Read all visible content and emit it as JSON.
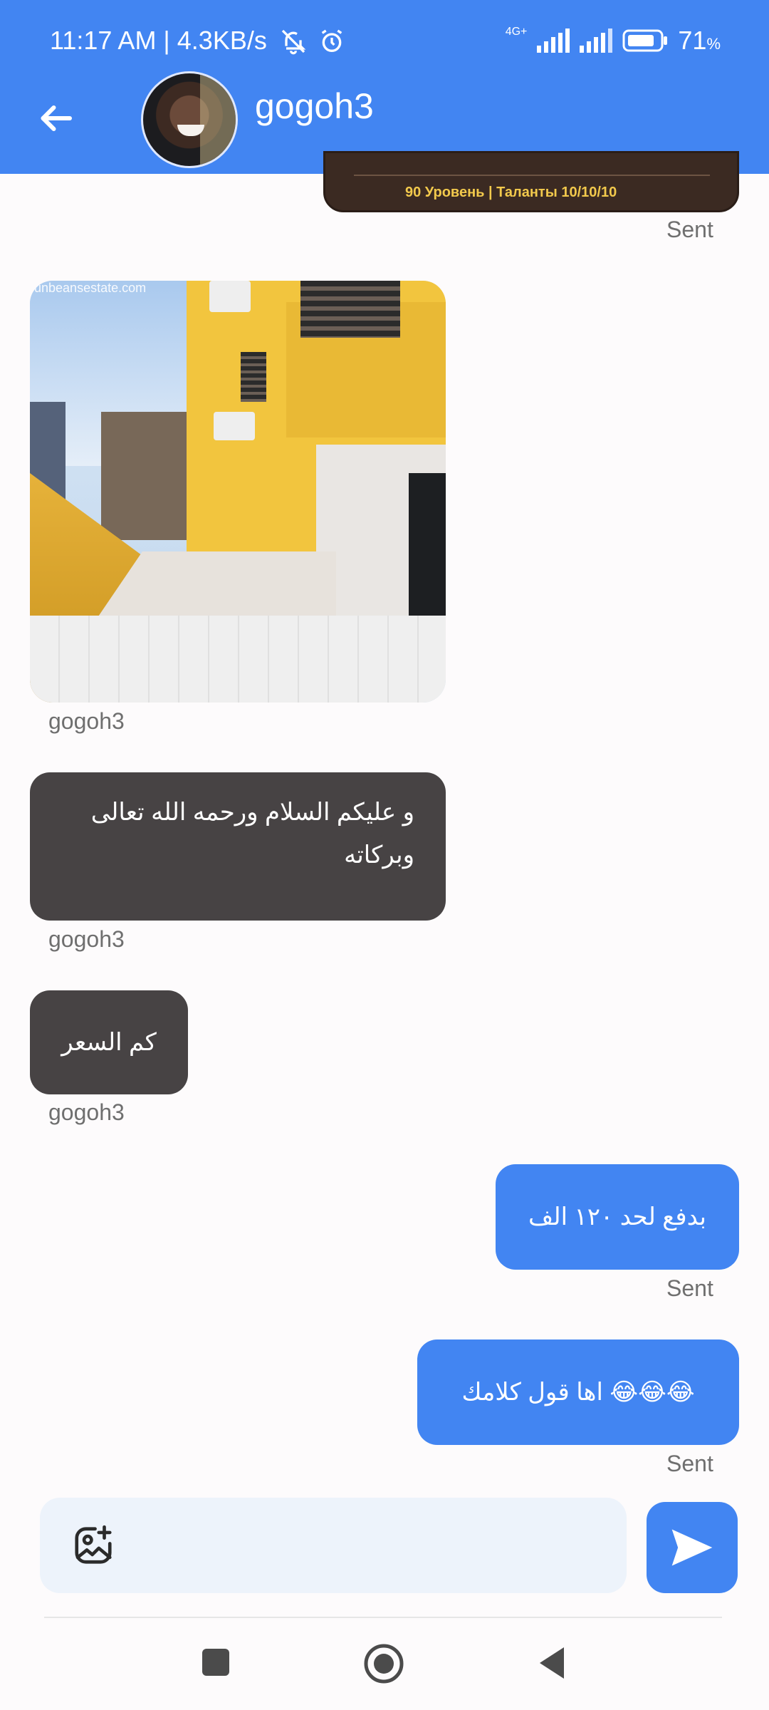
{
  "status_bar": {
    "time": "11:17 AM | 4.3KB/s",
    "network": "4G+",
    "battery": "71",
    "battery_unit": "%"
  },
  "header": {
    "back_icon": "arrow-left-icon",
    "contact_name": "gogoh3"
  },
  "previous_message": {
    "level_text": "90 Уровень | Таланты 10/10/10",
    "status": "Sent"
  },
  "messages": [
    {
      "type": "image",
      "sender": "gogoh3",
      "watermark": "unbeansestate.com"
    },
    {
      "type": "text",
      "direction": "received",
      "text": "و عليكم السلام ورحمه الله تعالى وبركاته",
      "sender": "gogoh3"
    },
    {
      "type": "text",
      "direction": "received",
      "text": "كم السعر",
      "sender": "gogoh3"
    },
    {
      "type": "text",
      "direction": "sent",
      "text": "بدفع لحد ١٢٠ الف",
      "status": "Sent"
    },
    {
      "type": "text",
      "direction": "sent",
      "text": "😂😂😂 اها قول كلامك",
      "status": "Sent"
    }
  ],
  "composer": {
    "attach_icon": "gallery-add-icon",
    "send_icon": "send-icon",
    "placeholder": ""
  },
  "nav_bar": {
    "recents_icon": "square-icon",
    "home_icon": "circle-icon",
    "back_icon": "triangle-back-icon"
  },
  "colors": {
    "primary": "#4285f2",
    "received_bubble": "#474344",
    "composer_bg": "#edf3fb"
  }
}
